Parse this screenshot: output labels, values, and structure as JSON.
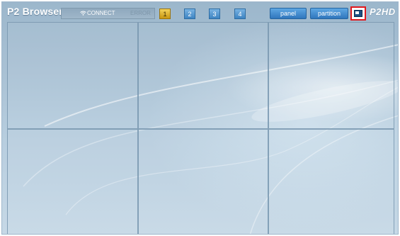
{
  "app": {
    "title": "P2 Browser",
    "logo": "P2HD"
  },
  "status": {
    "connect": "CONNECT",
    "error": "ERROR",
    "connect_icon": "wifi-icon"
  },
  "pages": [
    {
      "label": "1",
      "active": true
    },
    {
      "label": "2",
      "active": false
    },
    {
      "label": "3",
      "active": false
    },
    {
      "label": "4",
      "active": false
    }
  ],
  "toolbar": {
    "panel_label": "panel",
    "partition_label": "partition",
    "fullscreen_icon": "window-toggle-icon"
  },
  "colors": {
    "accent_blue": "#2f76bd",
    "active_page": "#e1b52a",
    "highlight_border": "#e0191e",
    "background": "#a9c1d4"
  },
  "viewer": {
    "rows": 2,
    "columns": 3
  }
}
